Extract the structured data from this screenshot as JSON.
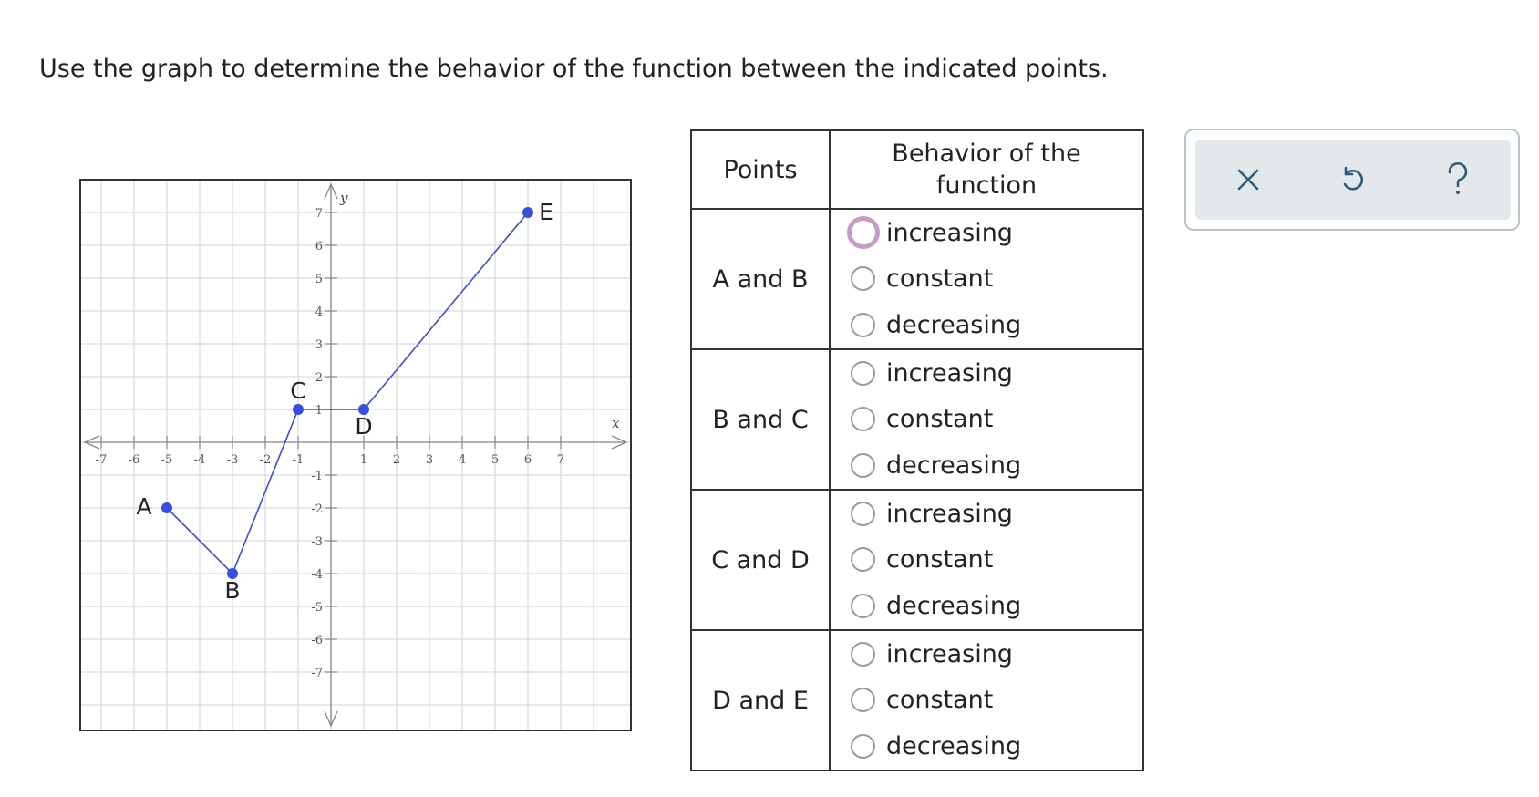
{
  "prompt": "Use the graph to determine the behavior of the function between the indicated points.",
  "chart_data": {
    "type": "line",
    "xlabel": "x",
    "ylabel": "y",
    "xlim": [
      -7,
      7
    ],
    "ylim": [
      -7,
      7
    ],
    "grid": true,
    "x_ticks": [
      "-7",
      "-6",
      "-5",
      "-4",
      "-3",
      "-2",
      "-1",
      "1",
      "2",
      "3",
      "4",
      "5",
      "6",
      "7"
    ],
    "y_ticks": [
      "7",
      "6",
      "5",
      "4",
      "3",
      "2",
      "1",
      "-1",
      "-2",
      "-3",
      "-4",
      "-5",
      "-6",
      "-7"
    ],
    "series": [
      {
        "points": [
          {
            "label": "A",
            "x": -5,
            "y": -2
          },
          {
            "label": "B",
            "x": -3,
            "y": -4
          },
          {
            "label": "C",
            "x": -1,
            "y": 1
          },
          {
            "label": "D",
            "x": 1,
            "y": 1
          },
          {
            "label": "E",
            "x": 6,
            "y": 7
          }
        ],
        "color": "#3a4de0"
      }
    ]
  },
  "table": {
    "header_points": "Points",
    "header_behavior_line1": "Behavior of the",
    "header_behavior_line2": "function",
    "rows": [
      {
        "points": "A and B",
        "options": [
          "increasing",
          "constant",
          "decreasing"
        ]
      },
      {
        "points": "B and C",
        "options": [
          "increasing",
          "constant",
          "decreasing"
        ]
      },
      {
        "points": "C and D",
        "options": [
          "increasing",
          "constant",
          "decreasing"
        ]
      },
      {
        "points": "D and E",
        "options": [
          "increasing",
          "constant",
          "decreasing"
        ]
      }
    ]
  },
  "toolbar": {
    "clear_icon": "close-icon",
    "undo_icon": "undo-icon",
    "help_icon": "help-icon",
    "icon_color": "#2e5c7a"
  }
}
